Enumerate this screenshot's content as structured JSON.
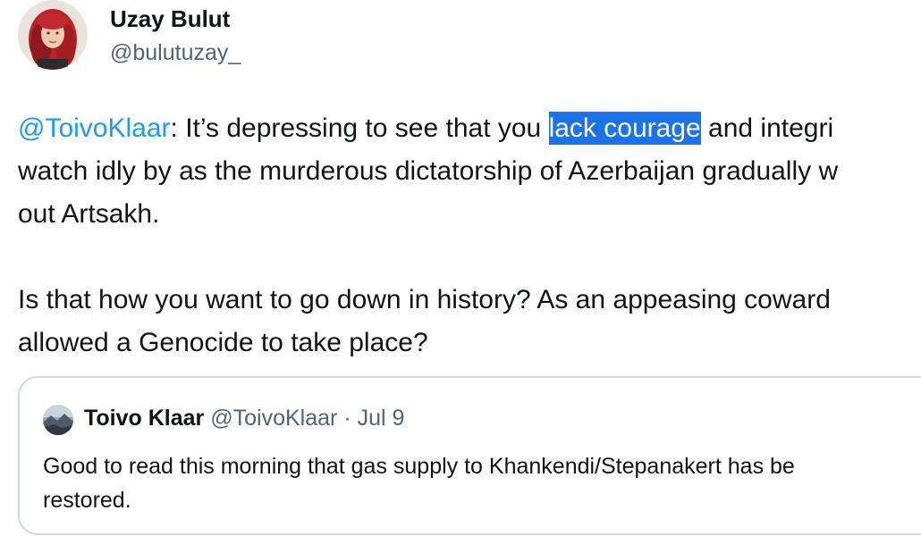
{
  "tweet": {
    "author_name": "Uzay Bulut",
    "author_handle": "@bulutuzay_",
    "mention": "@ToivoKlaar",
    "line1_after_mention": ": It’s depressing to see that you ",
    "line1_highlighted": "lack courage",
    "line1_end": " and integri",
    "line2": "watch idly by as the murderous dictatorship of Azerbaijan gradually w",
    "line3": "out Artsakh.",
    "line4": "Is that how you want to go down in history? As an appeasing coward",
    "line5": "allowed a Genocide to take place?"
  },
  "quoted_tweet": {
    "author_name": "Toivo Klaar",
    "author_handle": "@ToivoKlaar",
    "separator": " · ",
    "date": "Jul 9",
    "line1": "Good to read this morning that gas supply to Khankendi/Stepanakert has be",
    "line2": "restored."
  },
  "icons": {
    "author_avatar": "avatar-red-hair-woman",
    "quoted_avatar": "avatar-landscape"
  },
  "colors": {
    "mention": "#1d9bf0",
    "highlight_bg": "#1a73e8",
    "secondary_text": "#536471",
    "border": "#cfd9de"
  }
}
